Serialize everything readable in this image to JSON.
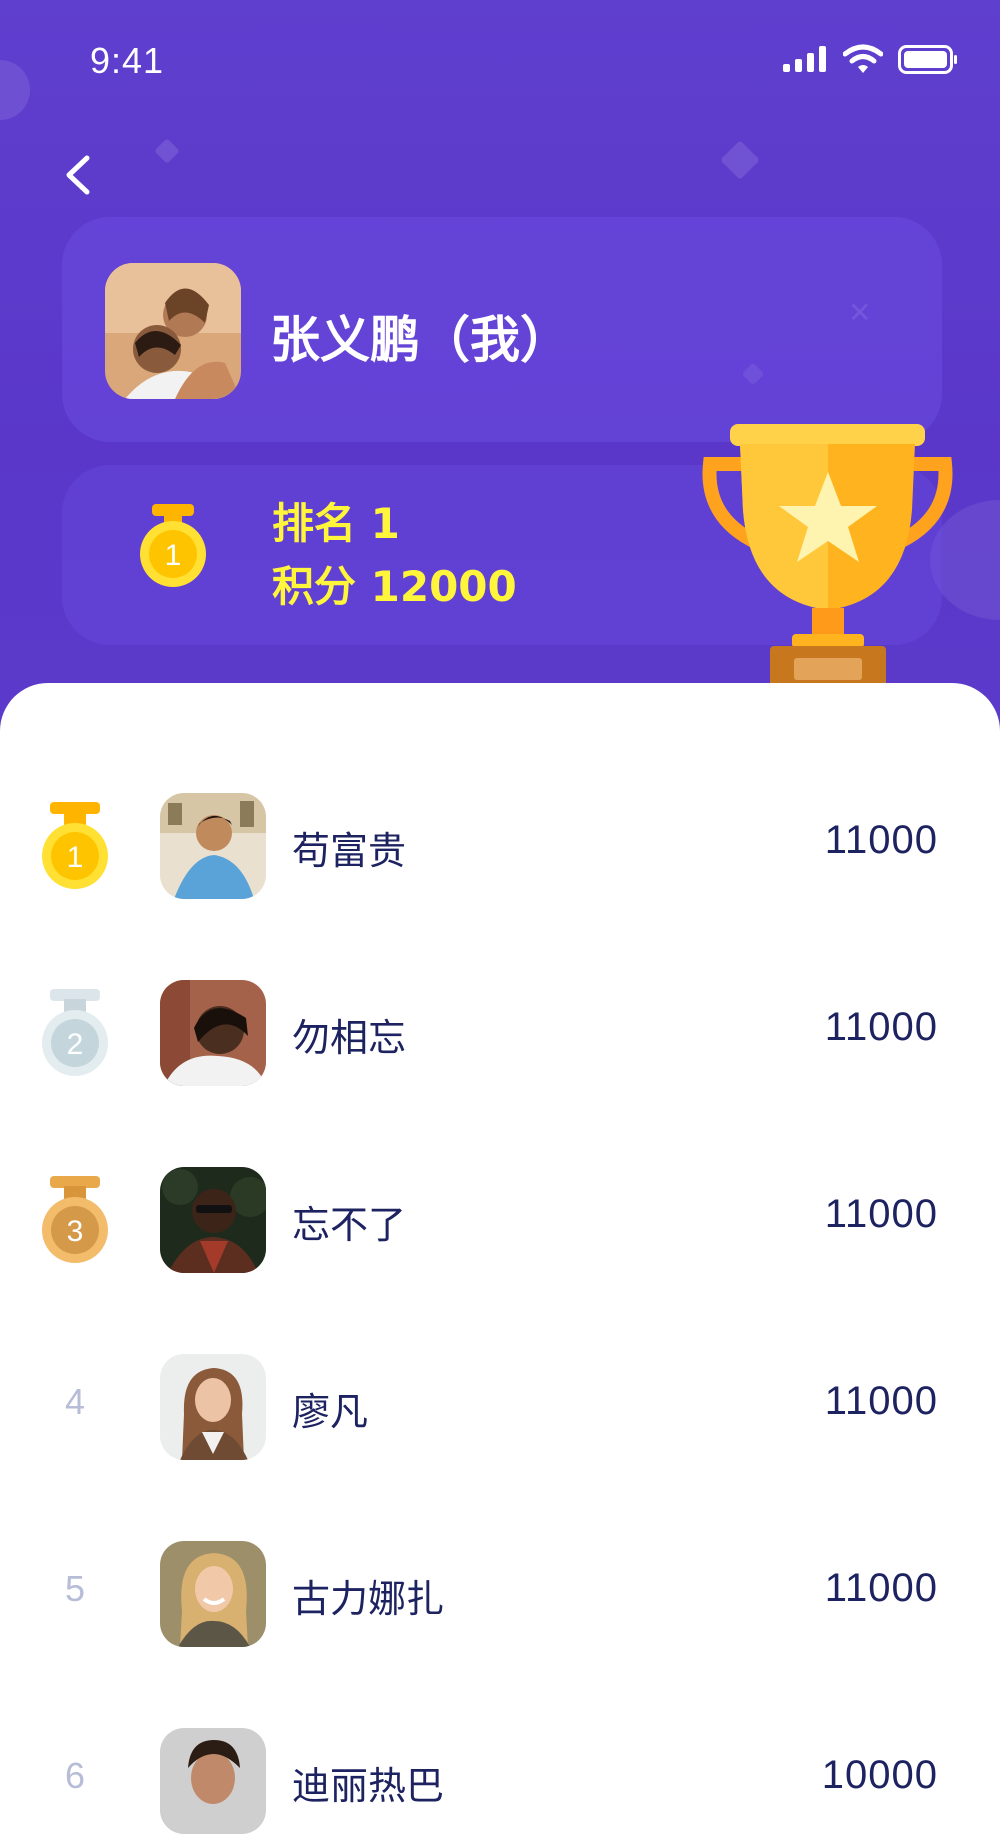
{
  "status_bar": {
    "time": "9:41"
  },
  "header": {
    "user_name": "张义鹏（我）",
    "rank_text": "排名 1",
    "score_text": "积分 12000",
    "my_medal_number": "1"
  },
  "leaderboard": [
    {
      "rank": "1",
      "name": "苟富贵",
      "score": "11000",
      "medal": "gold"
    },
    {
      "rank": "2",
      "name": "勿相忘",
      "score": "11000",
      "medal": "silver"
    },
    {
      "rank": "3",
      "name": " 忘不了",
      "score": "11000",
      "medal": "bronze"
    },
    {
      "rank": "4",
      "name": "廖凡",
      "score": "11000",
      "medal": ""
    },
    {
      "rank": "5",
      "name": "古力娜扎",
      "score": "11000",
      "medal": ""
    },
    {
      "rank": "6",
      "name": "迪丽热巴",
      "score": "10000",
      "medal": ""
    }
  ],
  "colors": {
    "header_bg": "#5b3bcb",
    "accent_yellow": "#fff53b",
    "text_dark": "#1d2260",
    "rank_gray": "#b7bdd6",
    "gold": "#ffc400",
    "silver": "#cfdde3",
    "bronze": "#e9a84a"
  },
  "icons": [
    "back-icon",
    "signal-icon",
    "wifi-icon",
    "battery-icon",
    "trophy-icon",
    "medal-icon"
  ]
}
